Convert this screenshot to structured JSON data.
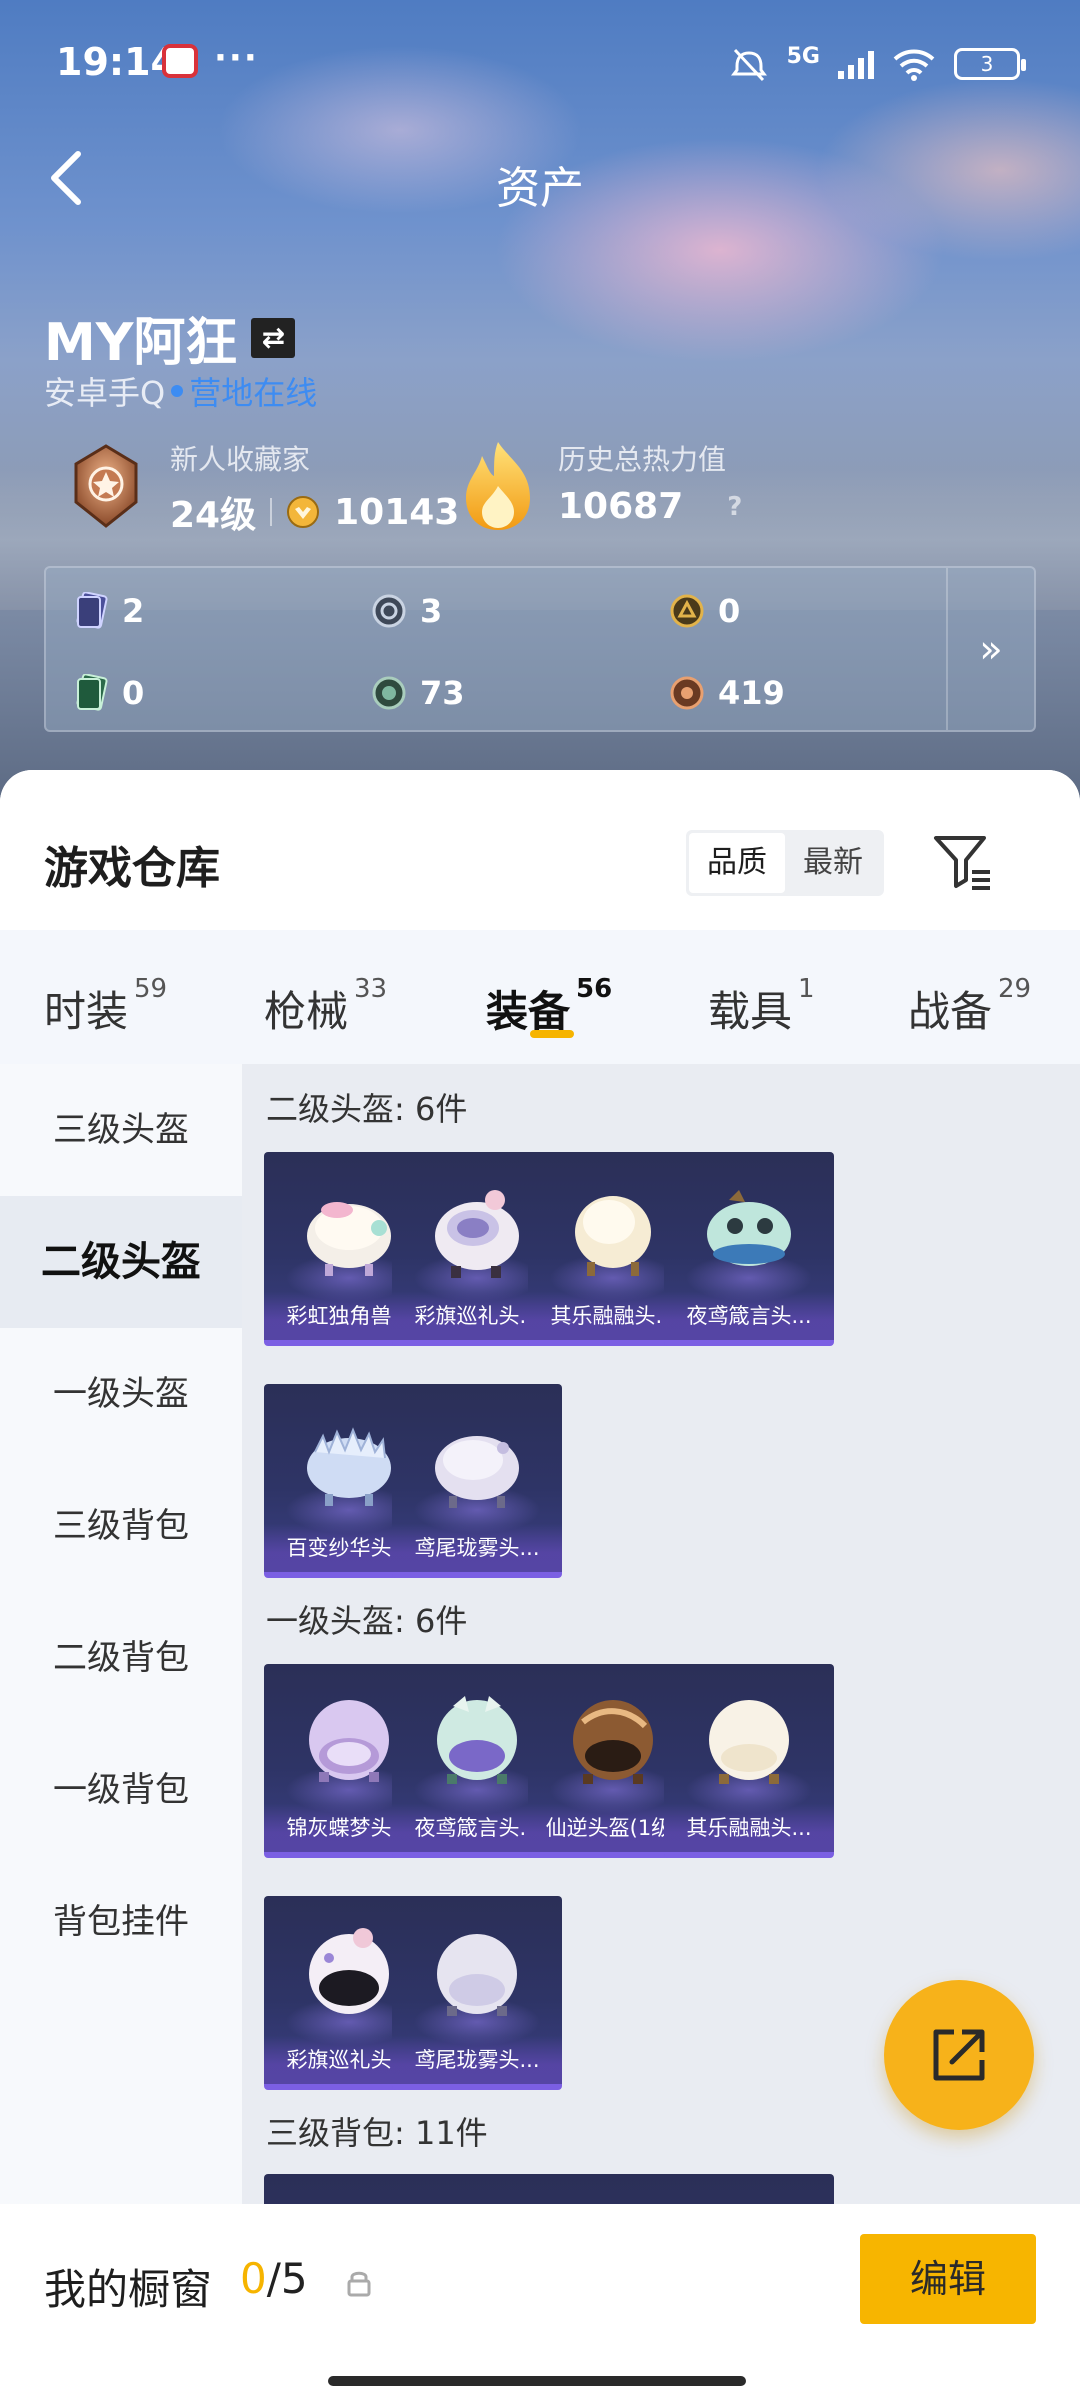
{
  "status": {
    "time": "19:14",
    "more": "···",
    "network": "5G",
    "battery": "3"
  },
  "header": {
    "title": "资产"
  },
  "user": {
    "name": "MY阿狂",
    "platform": "安卓手Q",
    "online_status": "营地在线"
  },
  "stats": {
    "collector_title": "新人收藏家",
    "level": "24级",
    "coins": "10143",
    "heat_label": "历史总热力值",
    "heat_value": "10687",
    "help": "?"
  },
  "resources": [
    {
      "icon": "card-purple-icon",
      "value": "2"
    },
    {
      "icon": "coin-silver-icon",
      "value": "3"
    },
    {
      "icon": "coin-gold-icon",
      "value": "0"
    },
    {
      "icon": "card-green-icon",
      "value": "0"
    },
    {
      "icon": "gem-green-icon",
      "value": "73"
    },
    {
      "icon": "coin-bronze-icon",
      "value": "419"
    }
  ],
  "resources_more": "»",
  "warehouse": {
    "title": "游戏仓库",
    "sort_options": [
      "品质",
      "最新"
    ],
    "sort_active": "品质"
  },
  "tabs": [
    {
      "label": "时装",
      "count": "59"
    },
    {
      "label": "枪械",
      "count": "33"
    },
    {
      "label": "装备",
      "count": "56"
    },
    {
      "label": "载具",
      "count": "1"
    },
    {
      "label": "战备",
      "count": "29"
    }
  ],
  "active_tab": "装备",
  "sidebar": [
    "三级头盔",
    "二级头盔",
    "一级头盔",
    "三级背包",
    "二级背包",
    "一级背包",
    "背包挂件"
  ],
  "sidebar_active": "二级头盔",
  "sections": [
    {
      "title": "二级头盔: 6件",
      "items": [
        "彩虹独角兽...",
        "彩旗巡礼头...",
        "其乐融融头...",
        "夜鸢箴言头...",
        "百变纱华头...",
        "鸢尾珑雾头..."
      ]
    },
    {
      "title": "一级头盔: 6件",
      "items": [
        "锦灰蝶梦头...",
        "夜鸢箴言头...",
        "仙逆头盔(1级)",
        "其乐融融头...",
        "彩旗巡礼头...",
        "鸢尾珑雾头..."
      ]
    },
    {
      "title": "三级背包: 11件",
      "items": []
    }
  ],
  "showcase": {
    "label": "我的橱窗",
    "current": "0",
    "total": "/5"
  },
  "edit_button": "编辑",
  "colors": {
    "accent": "#f6b400",
    "card_bg": "#2e3466",
    "card_border": "#7b5fe3",
    "online": "#3d8cf2"
  }
}
